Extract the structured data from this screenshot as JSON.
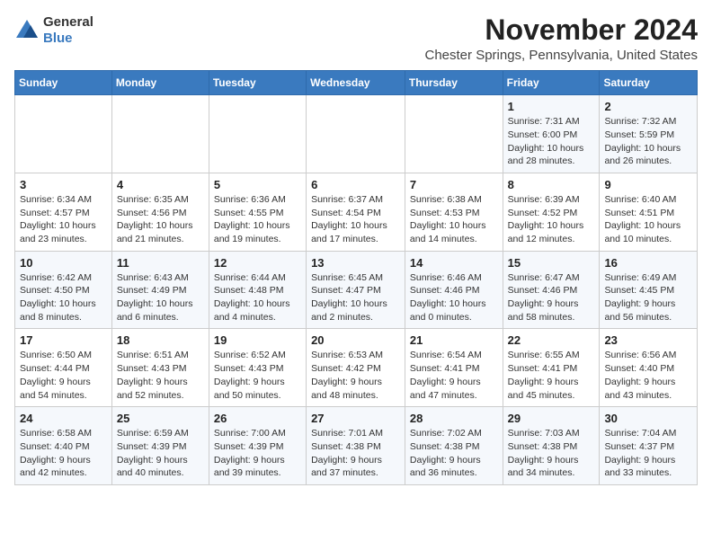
{
  "header": {
    "logo_line1": "General",
    "logo_line2": "Blue",
    "month": "November 2024",
    "location": "Chester Springs, Pennsylvania, United States"
  },
  "weekdays": [
    "Sunday",
    "Monday",
    "Tuesday",
    "Wednesday",
    "Thursday",
    "Friday",
    "Saturday"
  ],
  "weeks": [
    [
      {
        "day": "",
        "detail": ""
      },
      {
        "day": "",
        "detail": ""
      },
      {
        "day": "",
        "detail": ""
      },
      {
        "day": "",
        "detail": ""
      },
      {
        "day": "",
        "detail": ""
      },
      {
        "day": "1",
        "detail": "Sunrise: 7:31 AM\nSunset: 6:00 PM\nDaylight: 10 hours and 28 minutes."
      },
      {
        "day": "2",
        "detail": "Sunrise: 7:32 AM\nSunset: 5:59 PM\nDaylight: 10 hours and 26 minutes."
      }
    ],
    [
      {
        "day": "3",
        "detail": "Sunrise: 6:34 AM\nSunset: 4:57 PM\nDaylight: 10 hours and 23 minutes."
      },
      {
        "day": "4",
        "detail": "Sunrise: 6:35 AM\nSunset: 4:56 PM\nDaylight: 10 hours and 21 minutes."
      },
      {
        "day": "5",
        "detail": "Sunrise: 6:36 AM\nSunset: 4:55 PM\nDaylight: 10 hours and 19 minutes."
      },
      {
        "day": "6",
        "detail": "Sunrise: 6:37 AM\nSunset: 4:54 PM\nDaylight: 10 hours and 17 minutes."
      },
      {
        "day": "7",
        "detail": "Sunrise: 6:38 AM\nSunset: 4:53 PM\nDaylight: 10 hours and 14 minutes."
      },
      {
        "day": "8",
        "detail": "Sunrise: 6:39 AM\nSunset: 4:52 PM\nDaylight: 10 hours and 12 minutes."
      },
      {
        "day": "9",
        "detail": "Sunrise: 6:40 AM\nSunset: 4:51 PM\nDaylight: 10 hours and 10 minutes."
      }
    ],
    [
      {
        "day": "10",
        "detail": "Sunrise: 6:42 AM\nSunset: 4:50 PM\nDaylight: 10 hours and 8 minutes."
      },
      {
        "day": "11",
        "detail": "Sunrise: 6:43 AM\nSunset: 4:49 PM\nDaylight: 10 hours and 6 minutes."
      },
      {
        "day": "12",
        "detail": "Sunrise: 6:44 AM\nSunset: 4:48 PM\nDaylight: 10 hours and 4 minutes."
      },
      {
        "day": "13",
        "detail": "Sunrise: 6:45 AM\nSunset: 4:47 PM\nDaylight: 10 hours and 2 minutes."
      },
      {
        "day": "14",
        "detail": "Sunrise: 6:46 AM\nSunset: 4:46 PM\nDaylight: 10 hours and 0 minutes."
      },
      {
        "day": "15",
        "detail": "Sunrise: 6:47 AM\nSunset: 4:46 PM\nDaylight: 9 hours and 58 minutes."
      },
      {
        "day": "16",
        "detail": "Sunrise: 6:49 AM\nSunset: 4:45 PM\nDaylight: 9 hours and 56 minutes."
      }
    ],
    [
      {
        "day": "17",
        "detail": "Sunrise: 6:50 AM\nSunset: 4:44 PM\nDaylight: 9 hours and 54 minutes."
      },
      {
        "day": "18",
        "detail": "Sunrise: 6:51 AM\nSunset: 4:43 PM\nDaylight: 9 hours and 52 minutes."
      },
      {
        "day": "19",
        "detail": "Sunrise: 6:52 AM\nSunset: 4:43 PM\nDaylight: 9 hours and 50 minutes."
      },
      {
        "day": "20",
        "detail": "Sunrise: 6:53 AM\nSunset: 4:42 PM\nDaylight: 9 hours and 48 minutes."
      },
      {
        "day": "21",
        "detail": "Sunrise: 6:54 AM\nSunset: 4:41 PM\nDaylight: 9 hours and 47 minutes."
      },
      {
        "day": "22",
        "detail": "Sunrise: 6:55 AM\nSunset: 4:41 PM\nDaylight: 9 hours and 45 minutes."
      },
      {
        "day": "23",
        "detail": "Sunrise: 6:56 AM\nSunset: 4:40 PM\nDaylight: 9 hours and 43 minutes."
      }
    ],
    [
      {
        "day": "24",
        "detail": "Sunrise: 6:58 AM\nSunset: 4:40 PM\nDaylight: 9 hours and 42 minutes."
      },
      {
        "day": "25",
        "detail": "Sunrise: 6:59 AM\nSunset: 4:39 PM\nDaylight: 9 hours and 40 minutes."
      },
      {
        "day": "26",
        "detail": "Sunrise: 7:00 AM\nSunset: 4:39 PM\nDaylight: 9 hours and 39 minutes."
      },
      {
        "day": "27",
        "detail": "Sunrise: 7:01 AM\nSunset: 4:38 PM\nDaylight: 9 hours and 37 minutes."
      },
      {
        "day": "28",
        "detail": "Sunrise: 7:02 AM\nSunset: 4:38 PM\nDaylight: 9 hours and 36 minutes."
      },
      {
        "day": "29",
        "detail": "Sunrise: 7:03 AM\nSunset: 4:38 PM\nDaylight: 9 hours and 34 minutes."
      },
      {
        "day": "30",
        "detail": "Sunrise: 7:04 AM\nSunset: 4:37 PM\nDaylight: 9 hours and 33 minutes."
      }
    ]
  ]
}
